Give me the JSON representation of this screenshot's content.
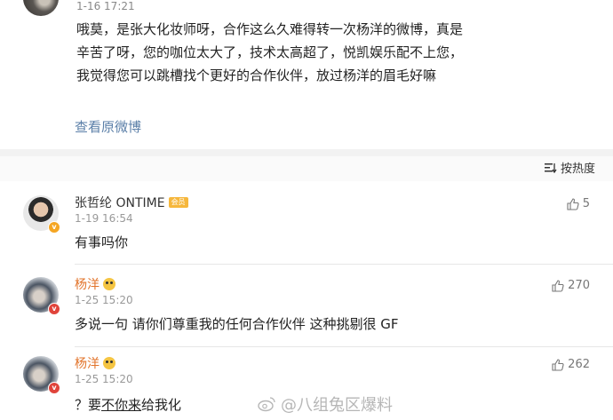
{
  "post": {
    "time": "1-16 17:21",
    "text": "哦莫，是张大化妆师呀，合作这么久难得转一次杨洋的微博，真是辛苦了呀，您的咖位太大了，技术太高超了，悦凯娱乐配不上您，我觉得您可以跳槽找个更好的合作伙伴，放过杨洋的眉毛好嘛",
    "view_original": "查看原微博"
  },
  "sort": {
    "label": "按热度"
  },
  "comments": [
    {
      "name": "张哲纶 ONTIME",
      "vip": "会员",
      "time": "1-19 16:54",
      "text": "有事吗你",
      "likes": "5"
    },
    {
      "name": "杨洋",
      "time": "1-25 15:20",
      "text": "多说一句 请你们尊重我的任何合作伙伴 这种挑剔很 GF",
      "likes": "270"
    },
    {
      "name": "杨洋",
      "time": "1-25 15:20",
      "text_prefix": "？要",
      "text_underline": "不你来",
      "text_suffix": "给我化",
      "likes": "262"
    }
  ],
  "watermark": {
    "text": "@八组兔区爆料"
  },
  "colors": {
    "link": "#5b7fa8",
    "vip_orange": "#e2732a",
    "background_band": "#f2f2f2"
  }
}
